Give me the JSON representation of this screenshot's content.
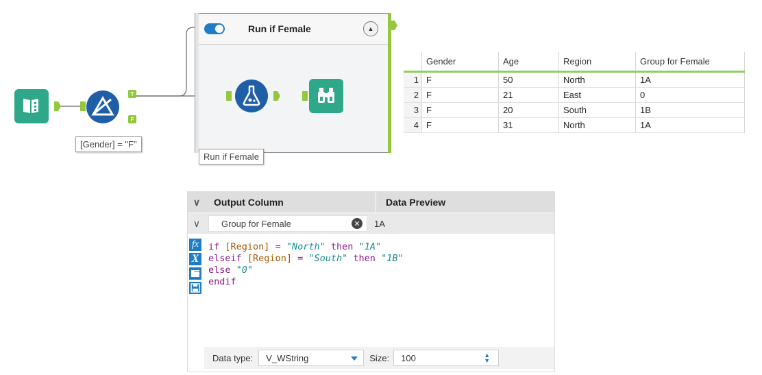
{
  "workflow": {
    "filter_annotation": "[Gender] = \"F\"",
    "filter_true_label": "T",
    "filter_false_label": "F",
    "container_title": "Run if Female",
    "container_annotation": "Run if Female",
    "icons": {
      "input": "book-icon",
      "filter": "filter-icon",
      "formula": "flask-icon",
      "browse": "binoculars-icon"
    },
    "colors": {
      "accent": "#1f7cc6",
      "anchor": "#93c73e",
      "browse": "#2fa88a",
      "input": "#2fa88a"
    }
  },
  "results": {
    "columns": [
      "Gender",
      "Age",
      "Region",
      "Group for Female"
    ],
    "rows": [
      {
        "n": "1",
        "cells": [
          "F",
          "50",
          "North",
          "1A"
        ]
      },
      {
        "n": "2",
        "cells": [
          "F",
          "21",
          "East",
          "0"
        ]
      },
      {
        "n": "3",
        "cells": [
          "F",
          "20",
          "South",
          "1B"
        ]
      },
      {
        "n": "4",
        "cells": [
          "F",
          "31",
          "North",
          "1A"
        ]
      }
    ]
  },
  "formula_panel": {
    "header_output_column": "Output Column",
    "header_data_preview": "Data Preview",
    "output_column_value": "Group for Female",
    "preview_value": "1A",
    "expression_lines": [
      "if [Region] = \"North\" then \"1A\"",
      "elseif [Region] = \"South\" then \"1B\"",
      "else \"0\"",
      "endif"
    ],
    "data_type_label": "Data type:",
    "data_type_value": "V_WString",
    "size_label": "Size:",
    "size_value": "100",
    "side_icons": [
      "function-icon",
      "variable-icon",
      "open-folder-icon",
      "save-icon"
    ]
  }
}
